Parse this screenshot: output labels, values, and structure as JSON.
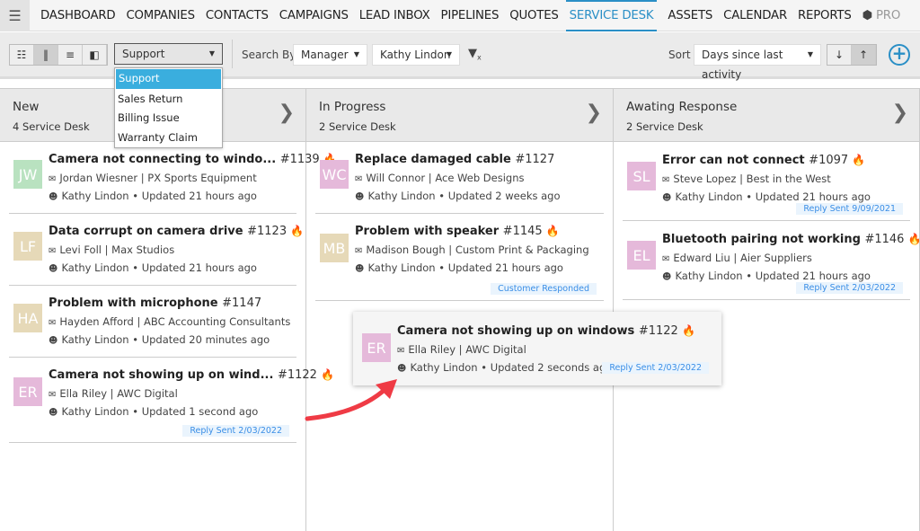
{
  "nav": {
    "items": [
      "DASHBOARD",
      "COMPANIES",
      "CONTACTS",
      "CAMPAIGNS",
      "LEAD INBOX",
      "PIPELINES",
      "QUOTES",
      "SERVICE DESK",
      "ASSETS",
      "CALENDAR",
      "REPORTS",
      "PRO"
    ],
    "active": "SERVICE DESK"
  },
  "toolbar": {
    "type_value": "Support",
    "type_options": [
      "Support",
      "Sales Return",
      "Billing Issue",
      "Warranty Claim"
    ],
    "search_by_label": "Search By",
    "search_by_value": "Manager",
    "manager_value": "Kathy Lindon",
    "sort_label": "Sort",
    "sort_value": "Days since last activity"
  },
  "columns": [
    {
      "title": "New",
      "count": "4 Service Desk",
      "cards": [
        {
          "initials": "JW",
          "color": "#b9e2c0",
          "title": "Camera not connecting to windo...",
          "num": "#1139",
          "hot": true,
          "contact": "Jordan Wiesner | PX Sports Equipment",
          "meta": "Kathy Lindon • Updated 21 hours ago"
        },
        {
          "initials": "LF",
          "color": "#e6d9b8",
          "title": "Data corrupt on camera drive",
          "num": "#1123",
          "hot": true,
          "contact": "Levi Foll | Max Studios",
          "meta": "Kathy Lindon • Updated 21 hours ago"
        },
        {
          "initials": "HA",
          "color": "#e6d9b8",
          "title": "Problem with microphone",
          "num": "#1147",
          "hot": false,
          "contact": "Hayden Afford | ABC Accounting Consultants",
          "meta": "Kathy Lindon • Updated 20 minutes ago"
        },
        {
          "initials": "ER",
          "color": "#e5b9da",
          "title": "Camera not showing up on wind...",
          "num": "#1122",
          "hot": true,
          "contact": "Ella Riley | AWC Digital",
          "meta": "Kathy Lindon • Updated 1 second ago",
          "badge": "Reply Sent 2/03/2022"
        }
      ]
    },
    {
      "title": "In Progress",
      "count": "2 Service Desk",
      "cards": [
        {
          "initials": "WC",
          "color": "#e5b9da",
          "title": "Replace damaged cable",
          "num": "#1127",
          "hot": false,
          "contact": "Will Connor | Ace Web Designs",
          "meta": "Kathy Lindon • Updated 2 weeks ago"
        },
        {
          "initials": "MB",
          "color": "#e6d9b8",
          "title": "Problem with speaker",
          "num": "#1145",
          "hot": true,
          "contact": "Madison Bough | Custom Print & Packaging",
          "meta": "Kathy Lindon • Updated 21 hours ago",
          "badge": "Customer Responded"
        }
      ]
    },
    {
      "title": "Awating Response",
      "count": "2 Service Desk",
      "cards": [
        {
          "initials": "SL",
          "color": "#e5b9da",
          "title": "Error can not connect",
          "num": "#1097",
          "hot": true,
          "contact": "Steve Lopez | Best in the West",
          "meta": "Kathy Lindon • Updated 21 hours ago",
          "badge": "Reply Sent 9/09/2021"
        },
        {
          "initials": "EL",
          "color": "#e5b9da",
          "title": "Bluetooth pairing not working",
          "num": "#1146",
          "hot": true,
          "contact": "Edward Liu | Aier Suppliers",
          "meta": "Kathy Lindon • Updated 21 hours ago",
          "badge": "Reply Sent 2/03/2022"
        }
      ]
    }
  ],
  "dragging": {
    "initials": "ER",
    "color": "#e5b9da",
    "title": "Camera not showing up on windows",
    "num": "#1122",
    "hot": true,
    "contact": "Ella Riley | AWC Digital",
    "meta": "Kathy Lindon • Updated 2 seconds ago",
    "badge": "Reply Sent 2/03/2022"
  },
  "colors": {
    "accent": "#2a8fc6",
    "hot": "#f5a10c",
    "arrow": "#ef3b45"
  }
}
